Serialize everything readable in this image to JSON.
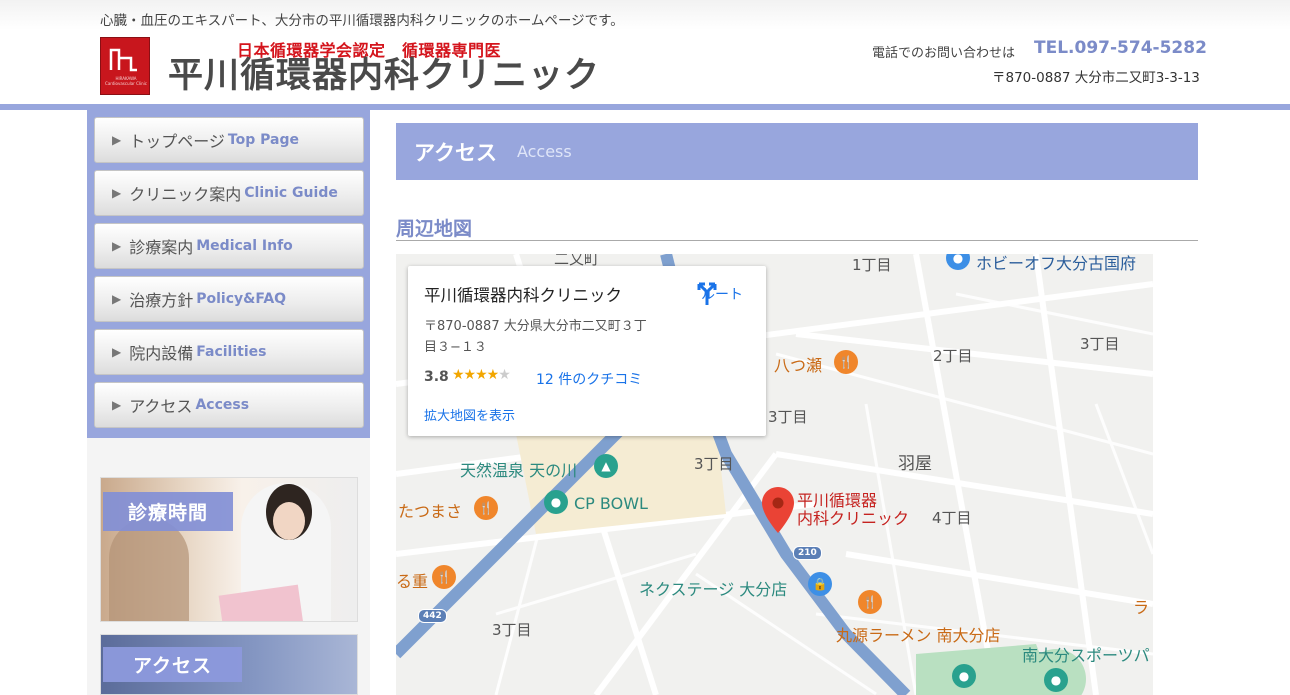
{
  "header": {
    "tagline": "心臓・血圧のエキスパート、大分市の平川循環器内科クリニックのホームページです。",
    "certification": "日本循環器学会認定　循環器専門医",
    "clinic_name": "平川循環器内科クリニック",
    "logo_subtext": "HIRAKAWA Cardiovascular Clinic",
    "tel_label": "電話でのお問い合わせは",
    "tel_number": "TEL.097-574-5282",
    "address": "〒870-0887 大分市二又町3-3-13"
  },
  "nav": [
    {
      "jp": "トップページ",
      "en": "Top Page"
    },
    {
      "jp": "クリニック案内",
      "en": "Clinic Guide"
    },
    {
      "jp": "診療案内",
      "en": "Medical Info"
    },
    {
      "jp": "治療方針",
      "en": "Policy&FAQ"
    },
    {
      "jp": "院内設備",
      "en": "Facilities"
    },
    {
      "jp": "アクセス",
      "en": "Access"
    }
  ],
  "banners": {
    "hours": "診療時間",
    "access": "アクセス"
  },
  "main": {
    "title": "アクセス",
    "title_en": "Access",
    "section_title": "周辺地図"
  },
  "map": {
    "card": {
      "name": "平川循環器内科クリニック",
      "address": "〒870-0887 大分県大分市二又町３丁目３−１３",
      "rating": "3.8",
      "reviews": "12 件のクチコミ",
      "enlarge": "拡大地図を表示",
      "route": "ルート"
    },
    "labels": {
      "futamata": "二又町",
      "chome1_top": "1丁目",
      "hobby_off": "ホビーオフ大分古国府",
      "yatsuse": "八つ瀬",
      "chome2": "2丁目",
      "chome3_right": "3丁目",
      "chome3_mid": "3丁目",
      "chome3_left": "3丁目",
      "haya": "羽屋",
      "tennen": "天然温泉 天の川",
      "cpbowl": "CP BOWL",
      "tatsumasa": "たつまさ",
      "clinic_pin_line1": "平川循環器",
      "clinic_pin_line2": "内科クリニック",
      "chome4": "4丁目",
      "ruju": "る重",
      "nextstage": "ネクステージ 大分店",
      "chome3_bottom": "3丁目",
      "marugen": "丸源ラーメン 南大分店",
      "minami_sports": "南大分スポーツパ",
      "ra": "ラ",
      "route210": "210",
      "route442": "442"
    }
  }
}
